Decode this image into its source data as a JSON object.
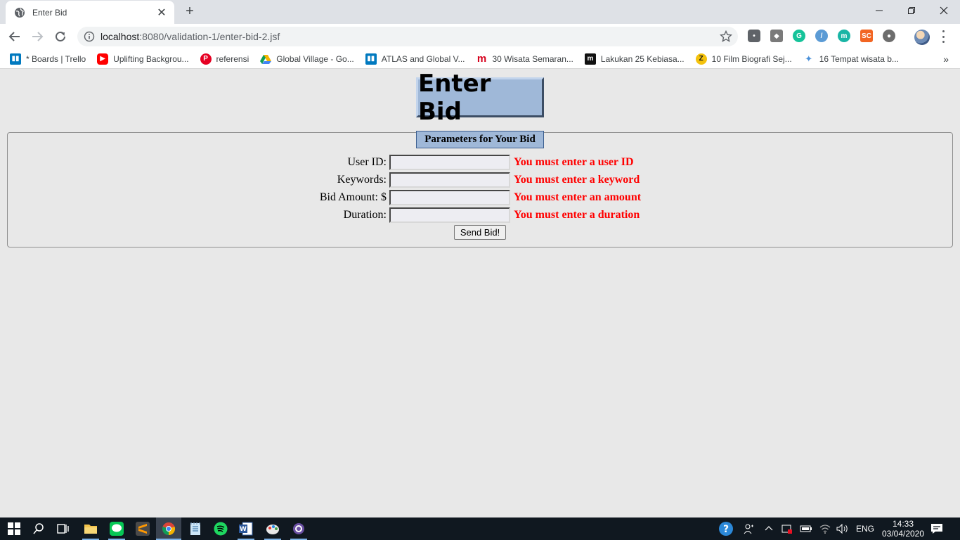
{
  "browser": {
    "tab_title": "Enter Bid",
    "url_host": "localhost",
    "url_rest": ":8080/validation-1/enter-bid-2.jsf"
  },
  "bookmarks": [
    {
      "label": "* Boards | Trello",
      "icon": "trello-icon",
      "color": "#0079bf"
    },
    {
      "label": "Uplifting Backgrou...",
      "icon": "youtube-icon",
      "color": "#ff0000"
    },
    {
      "label": "referensi",
      "icon": "pinterest-icon",
      "color": "#e60023"
    },
    {
      "label": "Global Village - Go...",
      "icon": "google-drive-icon",
      "color": "#1fa463"
    },
    {
      "label": "ATLAS and Global V...",
      "icon": "trello-icon",
      "color": "#0079bf"
    },
    {
      "label": "30 Wisata Semaran...",
      "icon": "m-logo-icon",
      "color": "#d6001c"
    },
    {
      "label": "Lakukan 25 Kebiasa...",
      "icon": "m-logo-dark-icon",
      "color": "#111111"
    },
    {
      "label": "10 Film Biografi Sej...",
      "icon": "z-logo-icon",
      "color": "#f4c20d"
    },
    {
      "label": "16 Tempat wisata b...",
      "icon": "bird-icon",
      "color": "#4a90d9"
    }
  ],
  "page": {
    "heading": "Enter Bid",
    "fieldset_legend": "Parameters for Your Bid",
    "fields": [
      {
        "label": "User ID:",
        "value": "",
        "error": "You must enter a user ID"
      },
      {
        "label": "Keywords:",
        "value": "",
        "error": "You must enter a keyword"
      },
      {
        "label": "Bid Amount: $",
        "value": "",
        "error": "You must enter an amount"
      },
      {
        "label": "Duration:",
        "value": "",
        "error": "You must enter a duration"
      }
    ],
    "submit_label": "Send Bid!"
  },
  "taskbar": {
    "language": "ENG",
    "time": "14:33",
    "date": "03/04/2020"
  },
  "colors": {
    "heading_bg": "#9fb8d8",
    "error_text": "#ff0000",
    "page_bg": "#e8e8e8"
  }
}
